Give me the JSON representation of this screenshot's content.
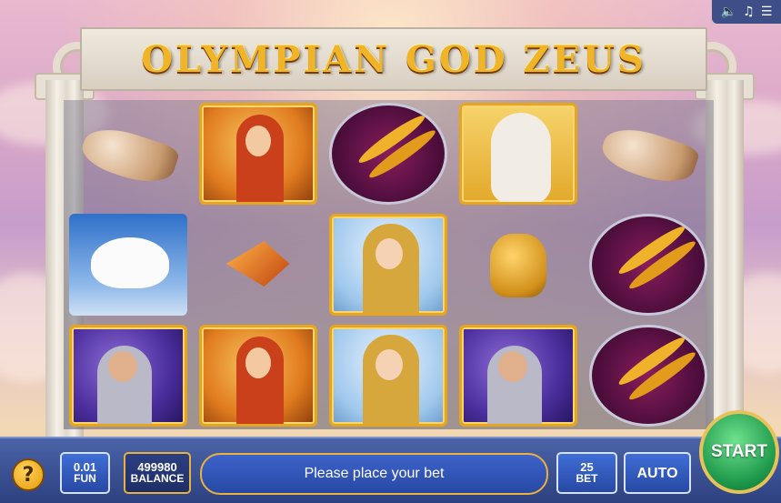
{
  "header": {
    "title": "OLYMPIAN GOD ZEUS"
  },
  "top_controls": {
    "icons": [
      "speaker-icon",
      "music-note-icon",
      "menu-icon"
    ]
  },
  "reels": {
    "rows": [
      [
        "shell",
        "athena",
        "laurel",
        "owl",
        "",
        "shell"
      ],
      [
        "dove",
        "spear",
        "aphrodite",
        "helmet",
        "laurel"
      ],
      [
        "zeus",
        "athena",
        "aphrodite",
        "zeus",
        "laurel"
      ]
    ]
  },
  "bottom_bar": {
    "help_label": "?",
    "coin_value": "0.01",
    "coin_label": "FUN",
    "balance_value": "499980",
    "balance_label": "BALANCE",
    "message": "Please place your bet",
    "bet_value": "25",
    "bet_label": "BET",
    "auto_label": "AUTO",
    "start_label": "START"
  },
  "colors": {
    "bar_blue": "#2d4180",
    "gold_accent": "#eab23d",
    "start_green": "#1f9a4c",
    "title_gold": "#f0b428"
  }
}
